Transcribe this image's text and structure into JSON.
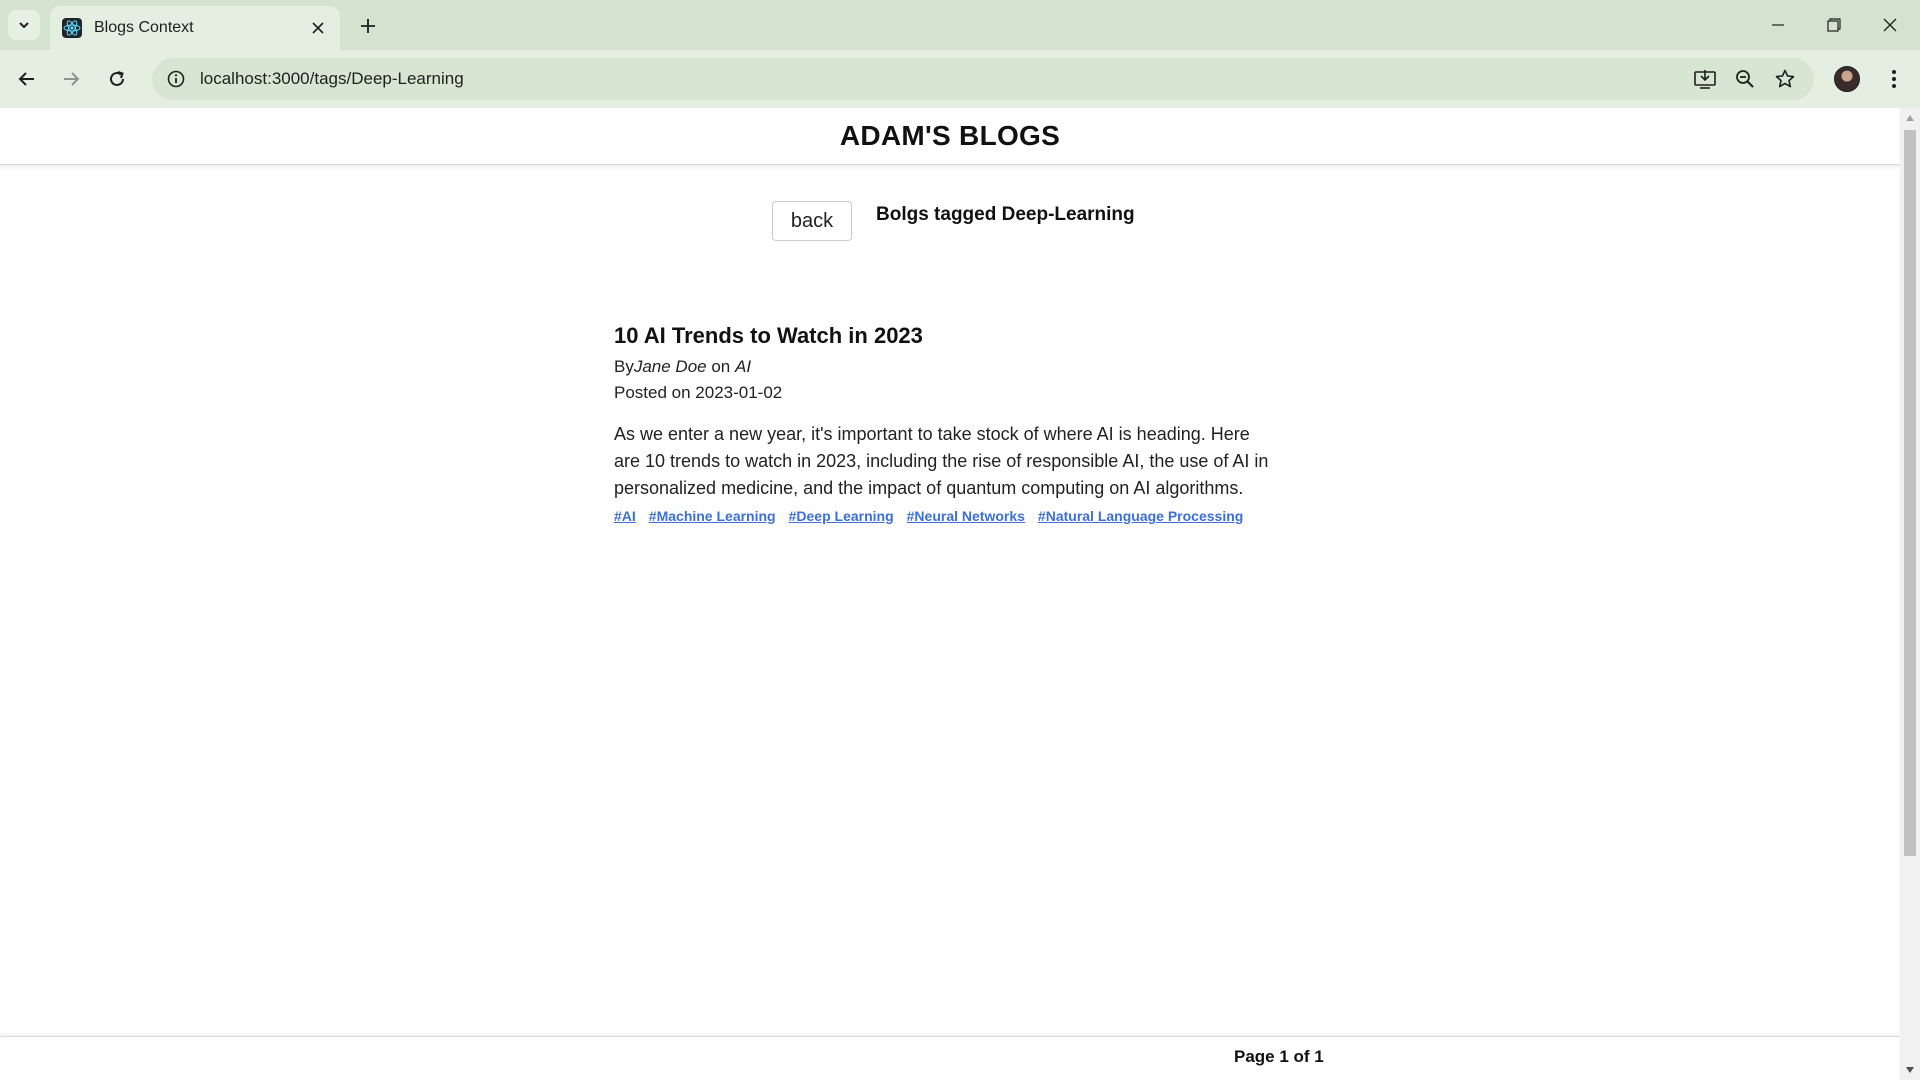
{
  "browser": {
    "tab_title": "Blogs Context",
    "url": "localhost:3000/tags/Deep-Learning",
    "colors": {
      "chrome": "#d3e3cf",
      "toolbar": "#e4eee1",
      "omnibox": "#d7e6d3"
    }
  },
  "site": {
    "title": "ADAM'S BLOGS"
  },
  "controls": {
    "back_label": "back",
    "heading": "Bolgs tagged Deep-Learning"
  },
  "post": {
    "title": "10 AI Trends to Watch in 2023",
    "by_prefix": "By",
    "author": "Jane Doe",
    "on_word": " on ",
    "category": "AI",
    "posted": "Posted on 2023-01-02",
    "excerpt": "As we enter a new year, it's important to take stock of where AI is heading. Here are 10 trends to watch in 2023, including the rise of responsible AI, the use of AI in personalized medicine, and the impact of quantum computing on AI algorithms.",
    "tags": [
      "#AI",
      "#Machine Learning",
      "#Deep Learning",
      "#Neural Networks",
      "#Natural Language Processing"
    ],
    "tag_color": "#3c6fd8"
  },
  "footer": {
    "page_info": "Page 1 of 1"
  }
}
